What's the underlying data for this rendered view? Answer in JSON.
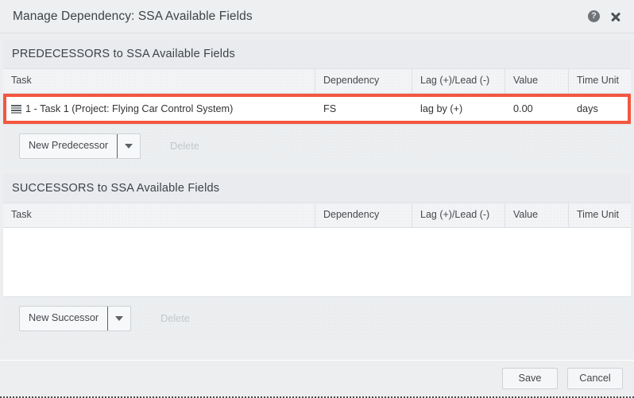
{
  "dialog": {
    "title": "Manage Dependency: SSA Available Fields",
    "help_icon": "question-mark-icon",
    "close_icon": "close-icon",
    "highlight_color": "#f4573f"
  },
  "predecessors": {
    "heading": "PREDECESSORS to SSA Available Fields",
    "columns": [
      "Task",
      "Dependency",
      "Lag (+)/Lead (-)",
      "Value",
      "Time Unit"
    ],
    "rows": [
      {
        "icon": "task-grid-icon",
        "task": "1 - Task 1 (Project: Flying Car Control System)",
        "dependency": "FS",
        "lag": "lag by (+)",
        "value": "0.00",
        "time_unit": "days",
        "highlighted": true
      }
    ],
    "toolbar": {
      "new_label": "New Predecessor",
      "dropdown_icon": "chevron-down-icon",
      "delete_label": "Delete",
      "delete_enabled": false
    }
  },
  "successors": {
    "heading": "SUCCESSORS to SSA Available Fields",
    "columns": [
      "Task",
      "Dependency",
      "Lag (+)/Lead (-)",
      "Value",
      "Time Unit"
    ],
    "rows": [],
    "toolbar": {
      "new_label": "New Successor",
      "dropdown_icon": "chevron-down-icon",
      "delete_label": "Delete",
      "delete_enabled": false
    }
  },
  "footer": {
    "save_label": "Save",
    "cancel_label": "Cancel"
  }
}
